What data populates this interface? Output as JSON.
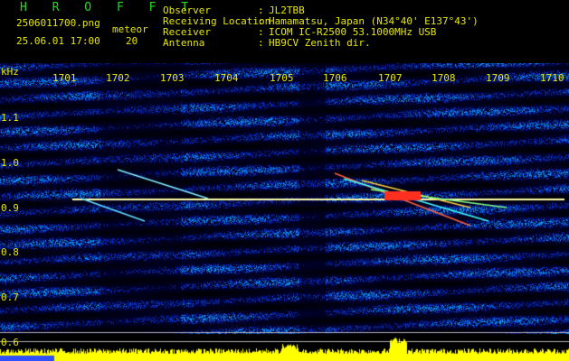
{
  "header": {
    "brand": "H R O F F T",
    "filename": "2506011700.png",
    "datetime": "25.06.01 17:00",
    "meteor_label": "meteor",
    "meteor_count": "20",
    "fields": [
      {
        "label": "Observer",
        "value": "JL2TBB"
      },
      {
        "label": "Receiving Location",
        "value": "Hamamatsu, Japan (N34°40' E137°43')"
      },
      {
        "label": "Receiver",
        "value": "ICOM IC-R2500 53.1000MHz USB"
      },
      {
        "label": "Antenna",
        "value": "HB9CV Zenith dir."
      }
    ]
  },
  "spectrogram": {
    "time_ticks": [
      "1701",
      "1702",
      "1703",
      "1704",
      "1705",
      "1706",
      "1707",
      "1708",
      "1709",
      "1710"
    ],
    "unit_label": "kHz",
    "freq_ticks": [
      "1.1",
      "1.0",
      "0.9",
      "0.8",
      "0.7",
      "0.6"
    ],
    "colors": {
      "background": "#000010",
      "signal": "#1a3aff",
      "level": "#ffff00",
      "carrier": "#ffff66"
    }
  }
}
